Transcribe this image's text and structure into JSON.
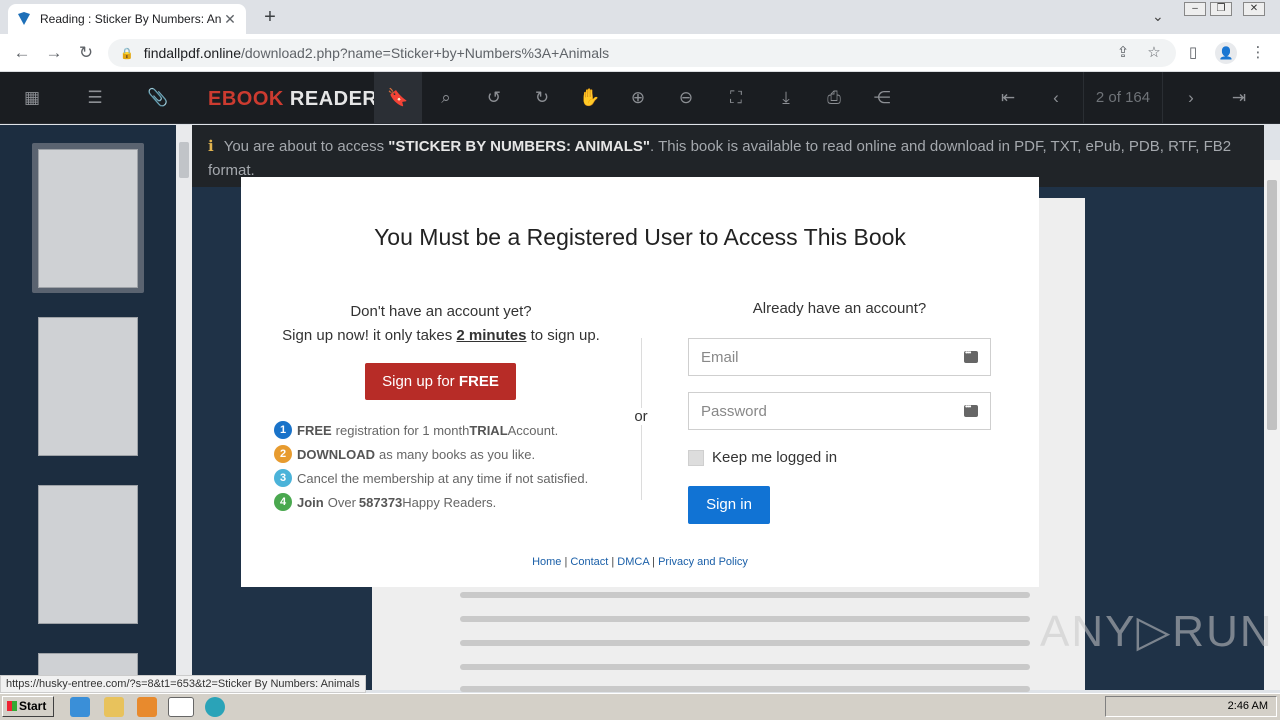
{
  "browser": {
    "tab_title": "Reading : Sticker By Numbers: Anim",
    "tab_close": "✕",
    "new_tab": "+",
    "url_domain": "findallpdf.online",
    "url_path": "/download2.php?name=Sticker+by+Numbers%3A+Animals"
  },
  "reader": {
    "brand_prefix": "EBOOK",
    "brand_suffix": "READER",
    "page_indicator": "2 of 164"
  },
  "notice": {
    "before": "You are about to access ",
    "book": "\"STICKER BY NUMBERS: ANIMALS\"",
    "after": ". This book is available to read online and download in PDF, TXT, ePub, PDB, RTF, FB2 format."
  },
  "modal": {
    "title": "You Must be a Registered User to Access This Book",
    "left_line1": "Don't have an account yet?",
    "left_line2_a": "Sign up now! it only takes ",
    "left_line2_b": "2 minutes",
    "left_line2_c": " to sign up.",
    "signup_a": "Sign up for ",
    "signup_b": "FREE",
    "or": "or",
    "steps": [
      {
        "num": "1",
        "bold": "FREE",
        "text": "registration for 1 month ",
        "bold2": "TRIAL",
        "text2": " Account.",
        "color": "#1a73c9"
      },
      {
        "num": "2",
        "bold": "DOWNLOAD",
        "text": "as many books as you like.",
        "bold2": "",
        "text2": "",
        "color": "#e79b2f"
      },
      {
        "num": "3",
        "bold": "",
        "text": "Cancel the membership at any time if not satisfied.",
        "bold2": "",
        "text2": "",
        "color": "#4bb3d9"
      },
      {
        "num": "4",
        "bold": "Join",
        "text": "Over ",
        "bold2": "587373",
        "text2": " Happy Readers.",
        "color": "#4aa84f"
      }
    ],
    "right_heading": "Already have an account?",
    "email_placeholder": "Email",
    "password_placeholder": "Password",
    "keep_logged": "Keep me logged in",
    "signin": "Sign in",
    "links": [
      "Home",
      "Contact",
      "DMCA",
      "Privacy and Policy"
    ],
    "link_sep": "|"
  },
  "status_url": "https://husky-entree.com/?s=8&t1=653&t2=Sticker By Numbers: Animals",
  "watermark": "ANY▷RUN",
  "taskbar": {
    "start": "Start",
    "time": "2:46 AM"
  }
}
